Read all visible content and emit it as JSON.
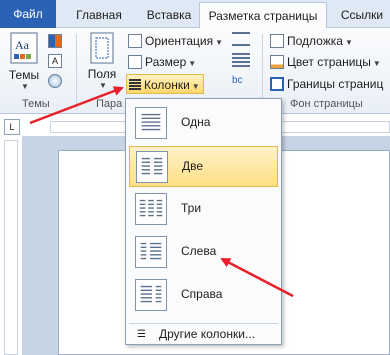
{
  "tabs": [
    {
      "label": "Файл"
    },
    {
      "label": "Главная"
    },
    {
      "label": "Вставка"
    },
    {
      "label": "Разметка страницы"
    },
    {
      "label": "Ссылки"
    }
  ],
  "ribbon": {
    "themes_label": "Темы",
    "themes_group": "Темы",
    "fields_label": "Поля",
    "page_setup_group": "Пара",
    "orientation": "Ориентация",
    "size": "Размер",
    "columns": "Колонки",
    "watermark": "Подложка",
    "page_color": "Цвет страницы",
    "page_borders": "Границы страниц",
    "background_group": "Фон страницы"
  },
  "ruler": {
    "corner": "L"
  },
  "columns_menu": {
    "items": [
      {
        "label": "Одна",
        "icon": "one-column-icon"
      },
      {
        "label": "Две",
        "icon": "two-columns-icon"
      },
      {
        "label": "Три",
        "icon": "three-columns-icon"
      },
      {
        "label": "Слева",
        "icon": "left-column-icon"
      },
      {
        "label": "Справа",
        "icon": "right-column-icon"
      }
    ],
    "selected_index": 1,
    "more": "Другие колонки..."
  },
  "colors": {
    "accent": "#2a62b6",
    "highlight": "#ffdf85",
    "annotation_arrow": "#e8202a"
  }
}
